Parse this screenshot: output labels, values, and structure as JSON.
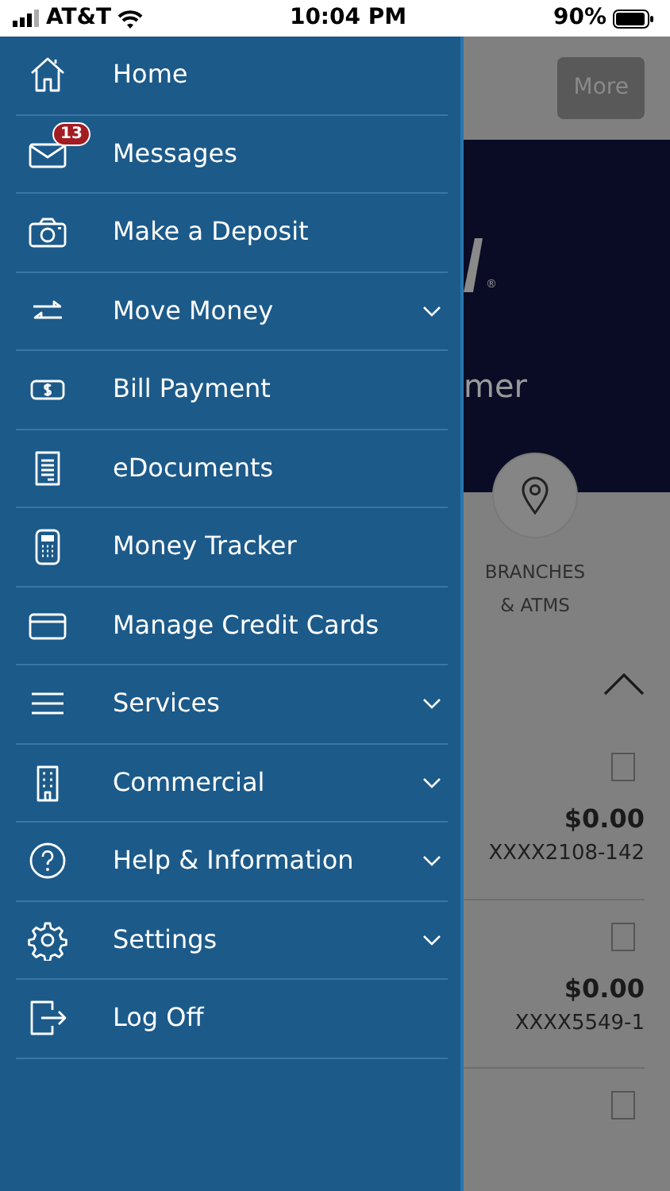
{
  "status_bar": {
    "carrier": "AT&T",
    "time": "10:04 PM",
    "battery": "90%"
  },
  "menu": [
    {
      "label": "Home",
      "submenu": false
    },
    {
      "label": "Messages",
      "submenu": false,
      "badge": "13"
    },
    {
      "label": "Make a Deposit",
      "submenu": false
    },
    {
      "label": "Move Money",
      "submenu": true
    },
    {
      "label": "Bill Payment",
      "submenu": false
    },
    {
      "label": "eDocuments",
      "submenu": false
    },
    {
      "label": "Money Tracker",
      "submenu": false
    },
    {
      "label": "Manage Credit Cards",
      "submenu": false
    },
    {
      "label": "Services",
      "submenu": true
    },
    {
      "label": "Commercial",
      "submenu": true
    },
    {
      "label": "Help & Information",
      "submenu": true
    },
    {
      "label": "Settings",
      "submenu": true
    },
    {
      "label": "Log Off",
      "submenu": false
    }
  ],
  "background": {
    "more_button": "More",
    "registered_mark": "®",
    "banner_text": "mer",
    "branches_label": [
      "BRANCHES",
      "& ATMS"
    ],
    "accounts": [
      {
        "amount": "$0.00",
        "number": "XXXX2108-142",
        "checked": false
      },
      {
        "amount": "$0.00",
        "number": "XXXX5549-1",
        "checked": false
      },
      {
        "checked": false
      }
    ]
  }
}
